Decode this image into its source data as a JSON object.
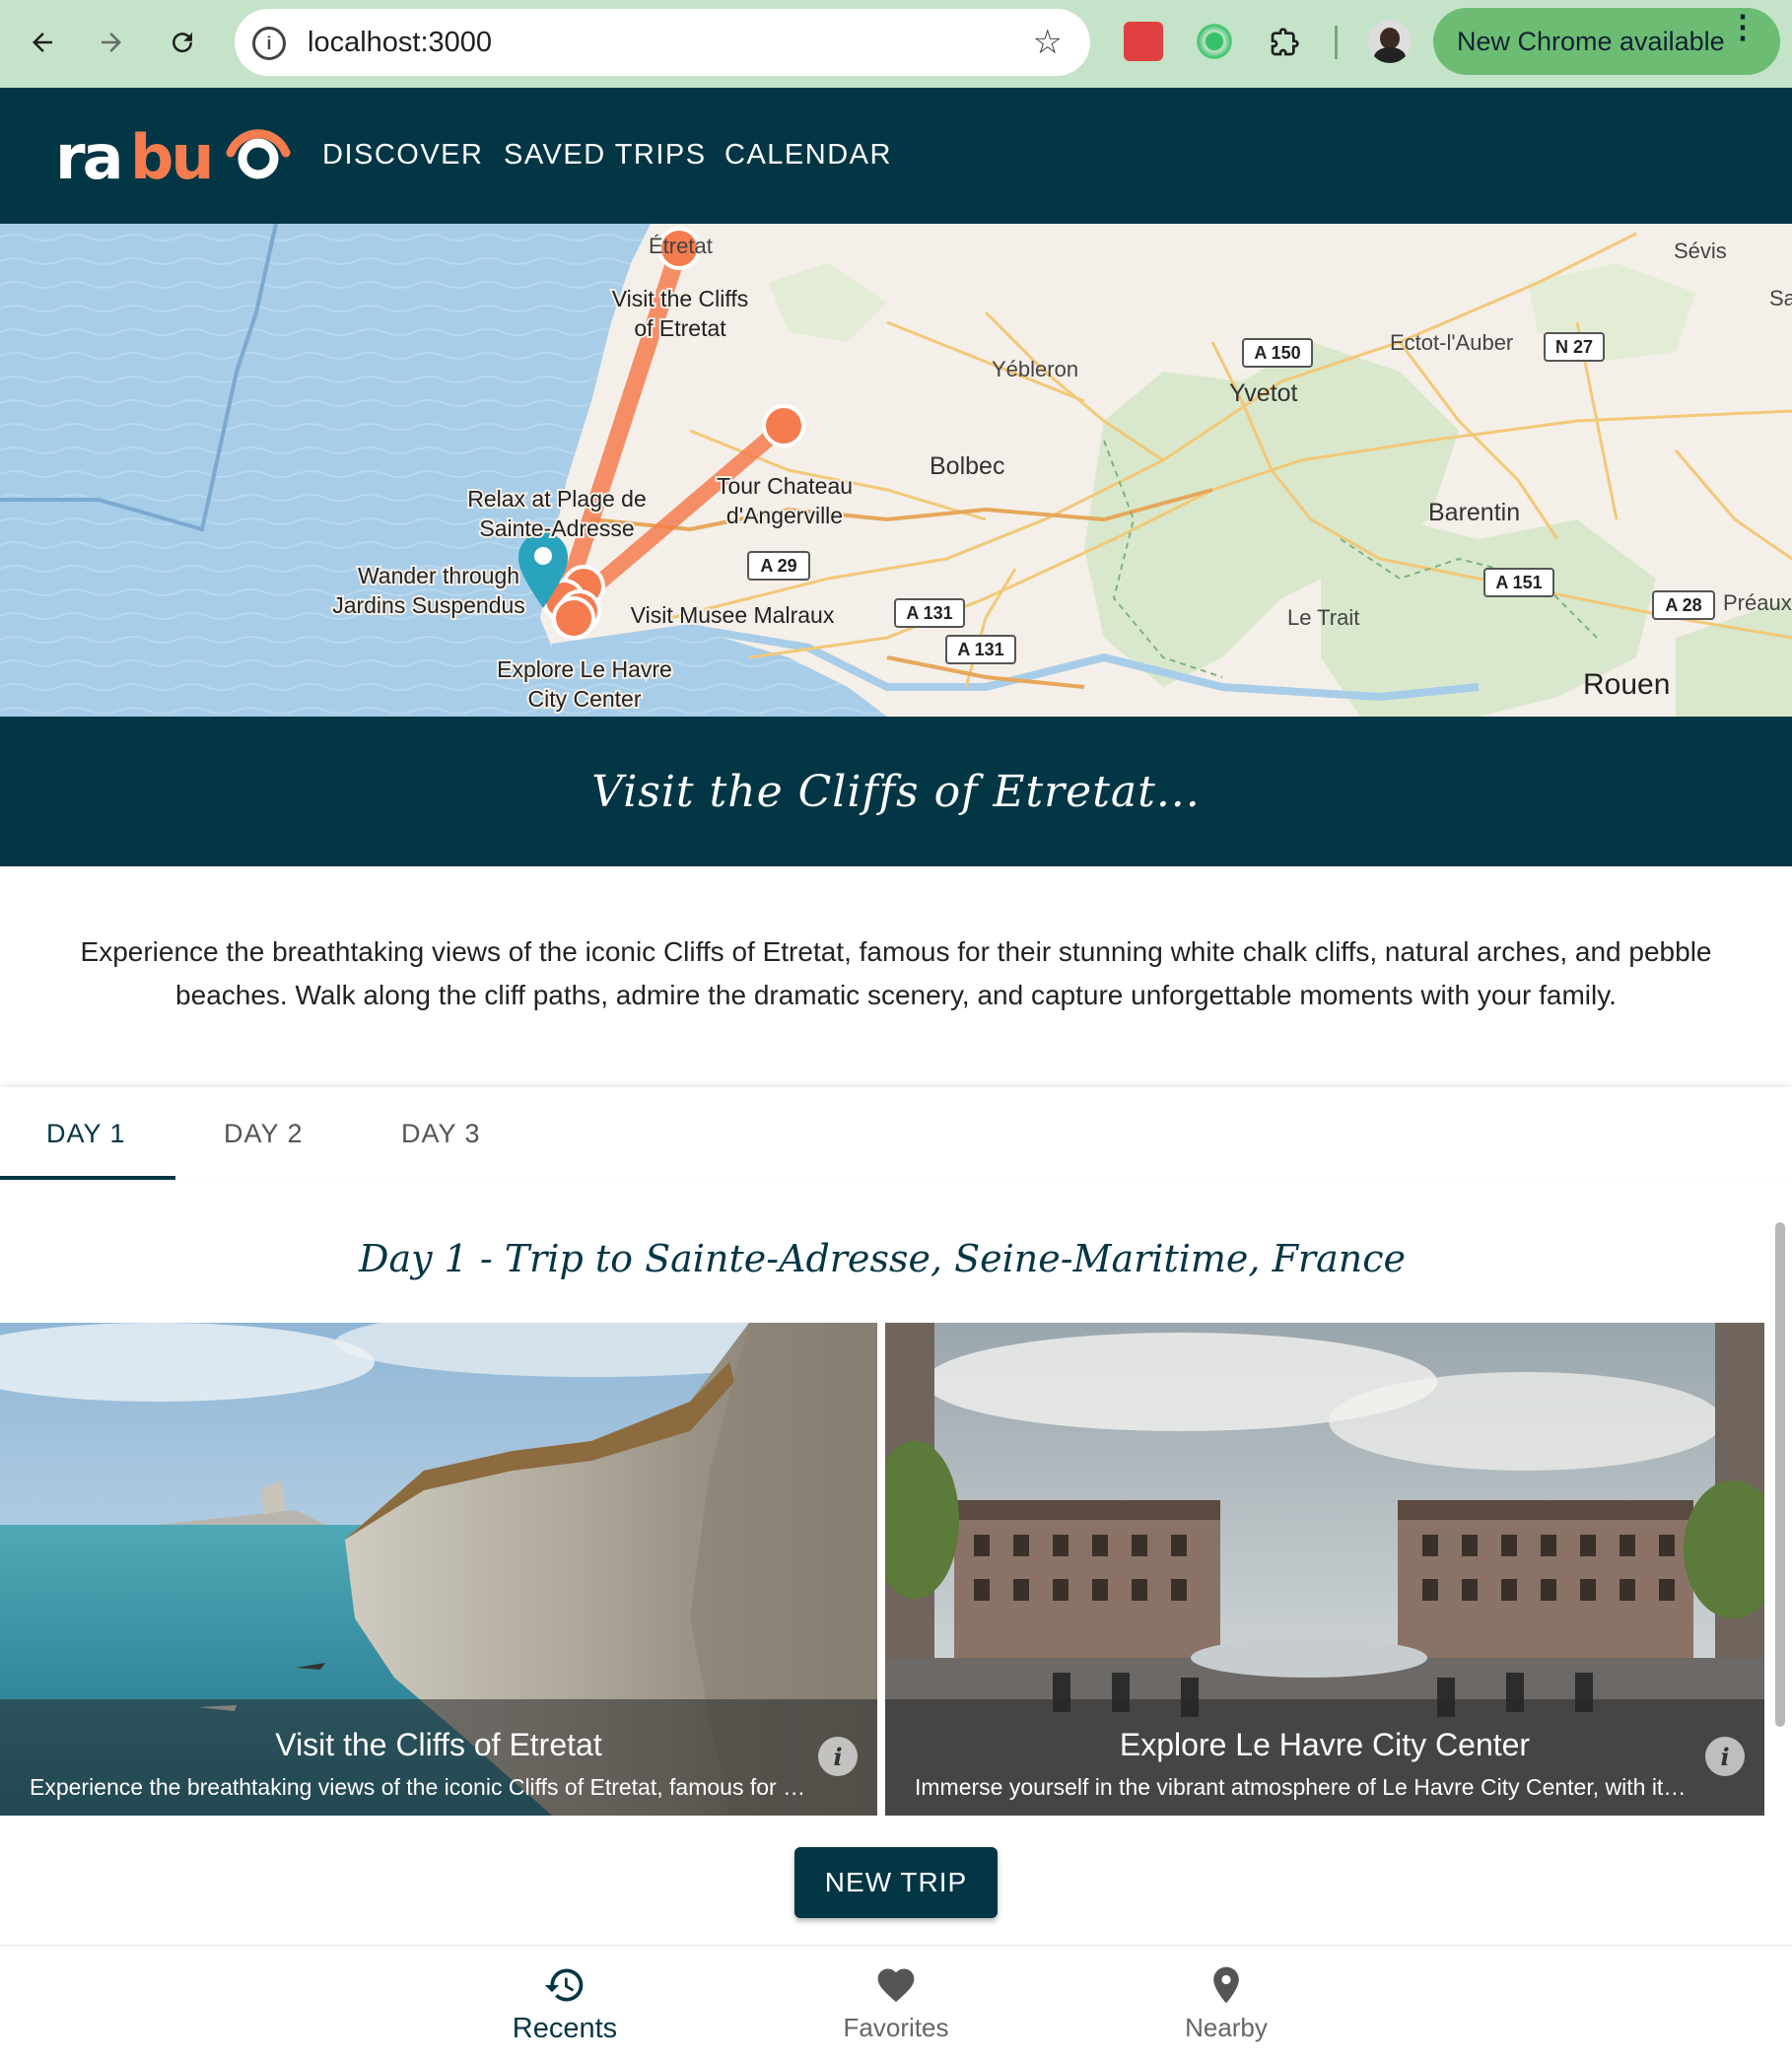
{
  "browser": {
    "url": "localhost:3000",
    "update_button": "New Chrome available"
  },
  "app": {
    "logo_text": "rabu",
    "nav": [
      "DISCOVER",
      "SAVED TRIPS",
      "CALENDAR"
    ]
  },
  "map": {
    "pois": [
      "Visit the Cliffs of Etretat",
      "Tour Chateau d'Angerville",
      "Relax at Plage de Sainte-Adresse",
      "Wander through Jardins Suspendus",
      "Visit Musee Malraux",
      "Explore Le Havre City Center"
    ],
    "poi_lines": {
      "cliffs": [
        "Visit the Cliffs",
        "of Etretat"
      ],
      "chateau": [
        "Tour Chateau",
        "d'Angerville"
      ],
      "plage": [
        "Relax at Plage de",
        "Sainte-Adresse"
      ],
      "jardins": [
        "Wander through",
        "Jardins Suspendus"
      ],
      "musee": "Visit Musee Malraux",
      "havre": [
        "Explore Le Havre",
        "City Center"
      ]
    },
    "places": {
      "etretat": "Étretat",
      "sevis": "Sévis",
      "sa": "Sa",
      "yebleron": "Yébleron",
      "yvetot": "Yvetot",
      "ectot": "Ectot-l'Auber",
      "bolbec": "Bolbec",
      "barentin": "Barentin",
      "letrait": "Le Trait",
      "preaux": "Préaux",
      "rouen": "Rouen"
    },
    "roads": {
      "a150": "A 150",
      "n27": "N 27",
      "a29": "A 29",
      "a131a": "A 131",
      "a131b": "A 131",
      "a151": "A 151",
      "a28": "A 28"
    },
    "route_color": "#f47c4f",
    "marker_color": "#2aa3be"
  },
  "hero": {
    "title": "Visit the Cliffs of Etretat..."
  },
  "description": "Experience the breathtaking views of the iconic Cliffs of Etretat, famous for their stunning white chalk cliffs, natural arches, and pebble beaches. Walk along the cliff paths, admire the dramatic scenery, and capture unforgettable moments with your family.",
  "tabs": [
    "DAY 1",
    "DAY 2",
    "DAY 3"
  ],
  "day": {
    "title": "Day 1 - Trip to Sainte-Adresse, Seine-Maritime, France",
    "cards": [
      {
        "title": "Visit the Cliffs of Etretat",
        "subtitle": "Experience the breathtaking views of the iconic Cliffs of Etretat, famous for their stunning white chalk cliffs"
      },
      {
        "title": "Explore Le Havre City Center",
        "subtitle": "Immerse yourself in the vibrant atmosphere of Le Havre City Center, with its modern architecture and lively squares"
      }
    ]
  },
  "actions": {
    "new_trip": "NEW TRIP"
  },
  "bottom_nav": [
    {
      "label": "Recents",
      "icon": "history-icon"
    },
    {
      "label": "Favorites",
      "icon": "heart-icon"
    },
    {
      "label": "Nearby",
      "icon": "location-pin-icon"
    }
  ],
  "colors": {
    "brand_dark": "#033645",
    "brand_orange": "#f47c4f"
  }
}
